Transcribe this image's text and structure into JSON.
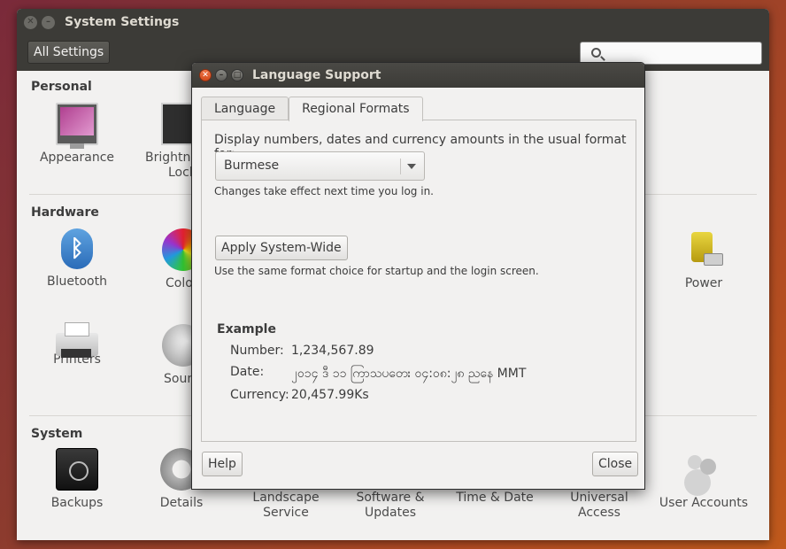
{
  "system_settings": {
    "title": "System Settings",
    "all_settings_label": "All Settings",
    "search_placeholder": "",
    "sections": {
      "personal": {
        "label": "Personal",
        "items": [
          "Appearance",
          "Brightne",
          "Lock"
        ]
      },
      "hardware": {
        "label": "Hardware",
        "items": [
          "Bluetooth",
          "Colo",
          "Power",
          "Printers",
          "Soun"
        ]
      },
      "system": {
        "label": "System",
        "items": [
          "Backups",
          "Details",
          "Landscape",
          "Service",
          "Software &",
          "Updates",
          "Time & Date",
          "Universal",
          "Access",
          "User Accounts"
        ]
      }
    }
  },
  "dialog": {
    "title": "Language Support",
    "tabs": [
      "Language",
      "Regional Formats"
    ],
    "active_tab": "Regional Formats",
    "prompt": "Display numbers, dates and currency amounts in the usual format for:",
    "format_value": "Burmese",
    "change_note": "Changes take effect next time you log in.",
    "apply_label": "Apply System-Wide",
    "apply_note": "Use the same format choice for startup and the login screen.",
    "example": {
      "title": "Example",
      "rows": [
        {
          "key": "Number:",
          "value": "1,234,567.89"
        },
        {
          "key": "Date:",
          "value": "၂၀၁၄ ဒီ ၁၁ ကြာသပတေး ဝ၄:ဝ၈:၂၈ ညနေ MMT"
        },
        {
          "key": "Currency:",
          "value": "20,457.99Ks"
        }
      ]
    },
    "help_label": "Help",
    "close_label": "Close"
  }
}
